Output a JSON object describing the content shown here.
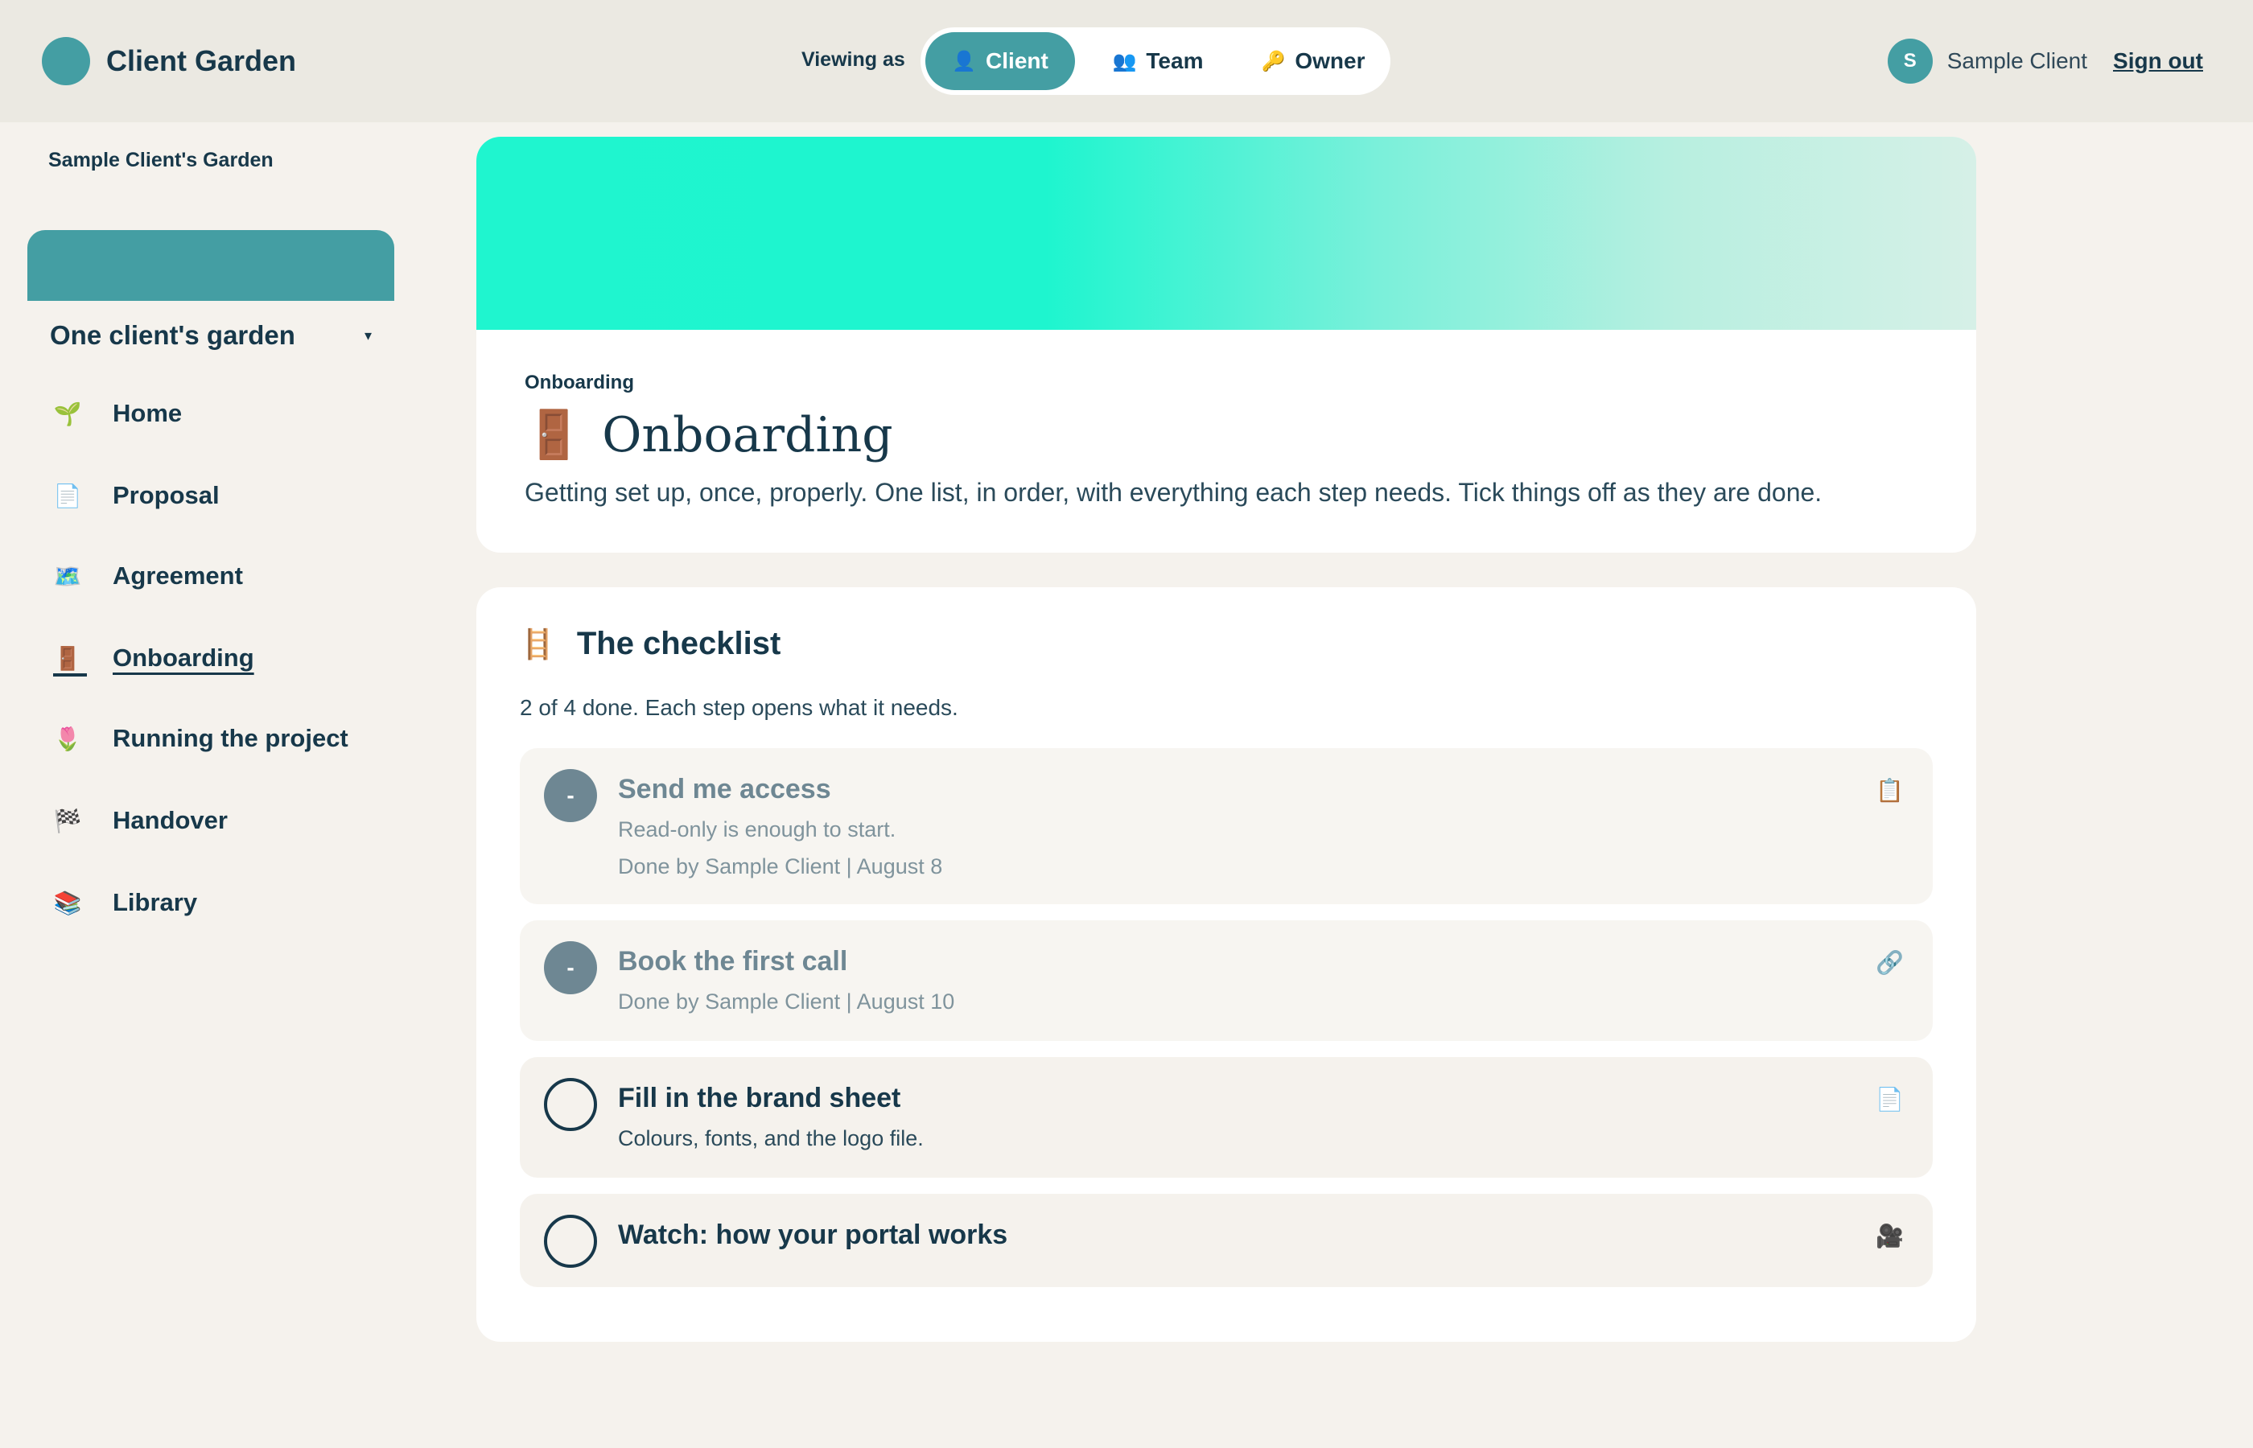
{
  "header": {
    "brand": "Client Garden",
    "viewing_as_label": "Viewing as",
    "roles": [
      {
        "label": "Client",
        "icon": "👤",
        "active": true
      },
      {
        "label": "Team",
        "icon": "👥",
        "active": false
      },
      {
        "label": "Owner",
        "icon": "🔑",
        "active": false
      }
    ],
    "user": {
      "initial": "S",
      "name": "Sample Client"
    },
    "sign_out": "Sign out"
  },
  "sidebar": {
    "garden_title": "Sample Client's Garden",
    "garden_select": {
      "label": "One client's garden",
      "caret": "▾"
    },
    "items": [
      {
        "label": "Home",
        "icon": "🌱",
        "active": false
      },
      {
        "label": "Proposal",
        "icon": "📄",
        "active": false
      },
      {
        "label": "Agreement",
        "icon": "🗺️",
        "active": false
      },
      {
        "label": "Onboarding",
        "icon": "🚪",
        "active": true
      },
      {
        "label": "Running the project",
        "icon": "🌷",
        "active": false
      },
      {
        "label": "Handover",
        "icon": "🏁",
        "active": false
      },
      {
        "label": "Library",
        "icon": "📚",
        "active": false
      }
    ]
  },
  "hero": {
    "kicker": "Onboarding",
    "icon": "🚪",
    "title": "Onboarding",
    "description": "Getting set up, once, properly. One list, in order, with everything each step needs. Tick things off as they are done."
  },
  "checklist": {
    "icon": "🪜",
    "title": "The checklist",
    "summary": "2 of 4 done. Each step opens what it needs.",
    "steps": [
      {
        "title": "Send me access",
        "done": true,
        "check": "-",
        "icon": "📋",
        "desc": "Read-only is enough to start.",
        "meta": "Done by Sample Client | August 8"
      },
      {
        "title": "Book the first call",
        "done": true,
        "check": "-",
        "icon": "🔗",
        "meta": "Done by Sample Client | August 10"
      },
      {
        "title": "Fill in the brand sheet",
        "done": false,
        "check": "",
        "icon": "📄",
        "desc": "Colours, fonts, and the logo file."
      },
      {
        "title": "Watch: how your portal works",
        "done": false,
        "check": "",
        "icon": "🎥"
      }
    ]
  }
}
